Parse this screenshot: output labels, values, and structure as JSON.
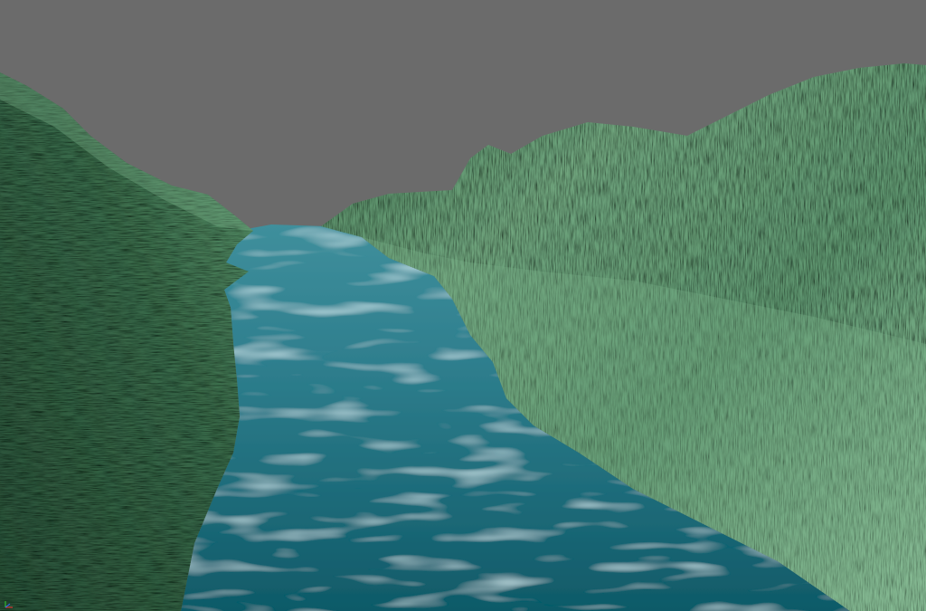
{
  "scene": {
    "sky_color": "#6b6b6b",
    "water_color_far": "#3f8f9c",
    "water_color_near": "#0f5a68",
    "terrain_color_light": "#8fc29c",
    "terrain_color_mid": "#4f8a62",
    "terrain_color_dark": "#1f3d2a"
  },
  "gizmo": {
    "icon": "axis-gizmo-icon",
    "x_color": "#ff3333",
    "y_color": "#33cc33",
    "z_color": "#3366ff"
  }
}
